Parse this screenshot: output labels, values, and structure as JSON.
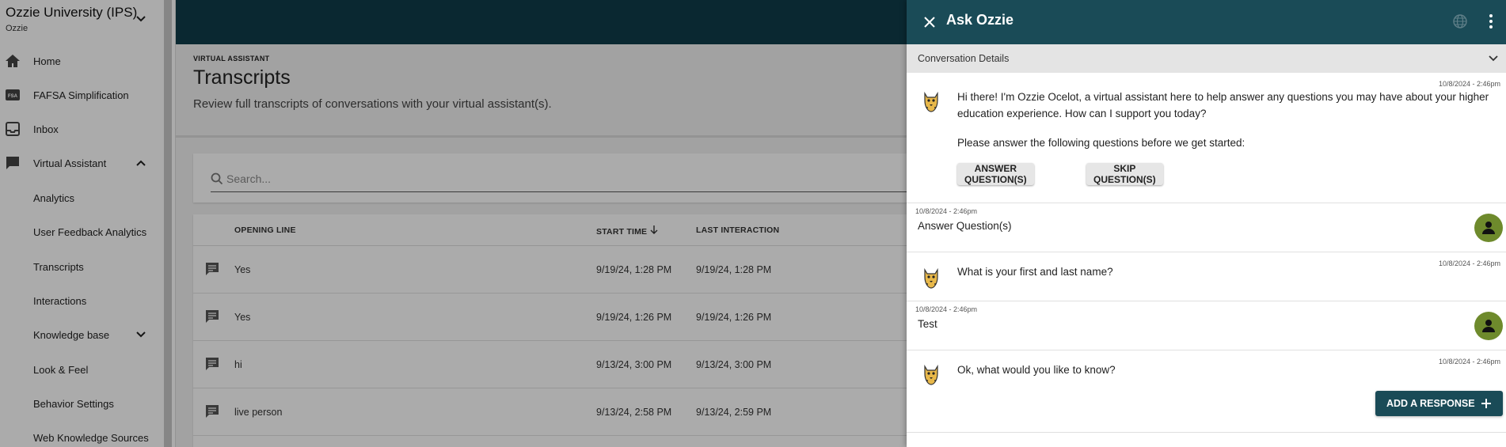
{
  "org": {
    "name": "Ozzie University (IPS)",
    "sub": "Ozzie"
  },
  "sidebar": {
    "items": [
      {
        "label": "Home",
        "icon": "home-icon"
      },
      {
        "label": "FAFSA Simplification",
        "icon": "fsa-icon"
      },
      {
        "label": "Inbox",
        "icon": "inbox-icon"
      },
      {
        "label": "Virtual Assistant",
        "icon": "chat-icon"
      }
    ],
    "sub_items": [
      {
        "label": "Analytics"
      },
      {
        "label": "User Feedback Analytics"
      },
      {
        "label": "Transcripts"
      },
      {
        "label": "Interactions"
      },
      {
        "label": "Knowledge base"
      },
      {
        "label": "Look & Feel"
      },
      {
        "label": "Behavior Settings"
      },
      {
        "label": "Web Knowledge Sources"
      }
    ]
  },
  "page": {
    "kicker": "VIRTUAL ASSISTANT",
    "title": "Transcripts",
    "description": "Review full transcripts of conversations with your virtual assistant(s)."
  },
  "search": {
    "placeholder": "Search..."
  },
  "table": {
    "columns": {
      "opening": "OPENING LINE",
      "start": "START TIME",
      "last": "LAST INTERACTION"
    },
    "rows": [
      {
        "opening": "Yes",
        "start": "9/19/24, 1:28 PM",
        "last": "9/19/24, 1:28 PM"
      },
      {
        "opening": "Yes",
        "start": "9/19/24, 1:26 PM",
        "last": "9/19/24, 1:26 PM"
      },
      {
        "opening": "hi",
        "start": "9/13/24, 3:00 PM",
        "last": "9/13/24, 3:00 PM"
      },
      {
        "opening": "live person",
        "start": "9/13/24, 2:58 PM",
        "last": "9/13/24, 2:59 PM"
      }
    ]
  },
  "panel": {
    "title": "Ask Ozzie",
    "details_label": "Conversation Details",
    "messages": [
      {
        "sender": "bot",
        "time": "10/8/2024 - 2:46pm",
        "text": "Hi there! I'm Ozzie Ocelot, a virtual assistant here to help answer any questions you may have about your higher education experience. How can I support you today?",
        "text2": "Please answer the following questions before we get started:",
        "buttons": [
          "ANSWER QUESTION(S)",
          "SKIP QUESTION(S)"
        ]
      },
      {
        "sender": "user",
        "time": "10/8/2024 - 2:46pm",
        "text": "Answer Question(s)"
      },
      {
        "sender": "bot",
        "time": "10/8/2024 - 2:46pm",
        "text": "What is your first and last name?"
      },
      {
        "sender": "user",
        "time": "10/8/2024 - 2:46pm",
        "text": "Test"
      },
      {
        "sender": "bot",
        "time": "10/8/2024 - 2:46pm",
        "text": "Ok, what would you like to know?"
      }
    ],
    "add_response_label": "ADD A RESPONSE"
  },
  "colors": {
    "header": "#0f3d4a",
    "panel_header": "#1a4b57",
    "user_avatar": "#6e8a2c"
  }
}
